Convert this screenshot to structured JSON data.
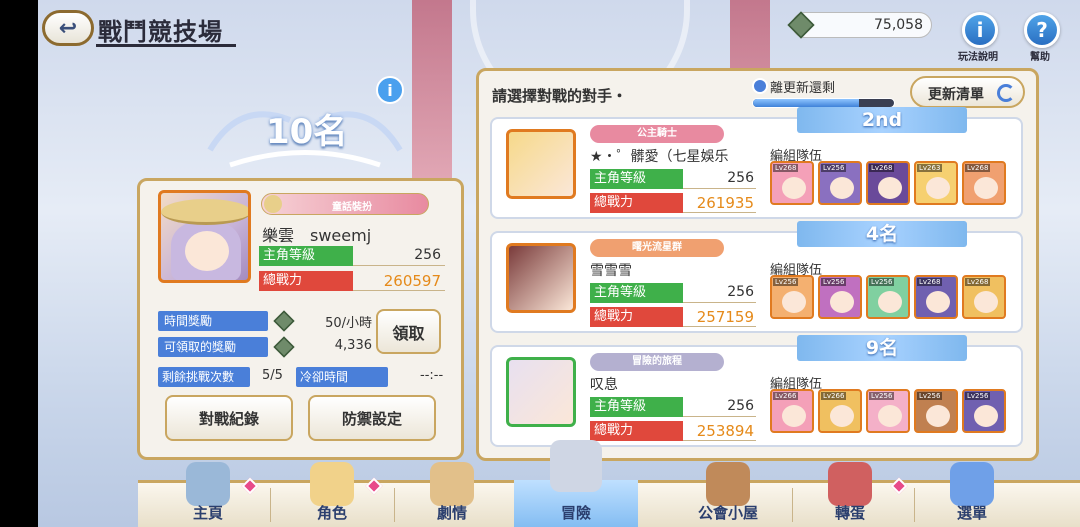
{
  "header": {
    "title": "戰鬥競技場",
    "currency_value": "75,058",
    "help_rules_label": "玩法說明",
    "help_label": "幫助"
  },
  "player": {
    "rank": "10名",
    "title_badge": "童話裝扮",
    "name": "樂雲　sweemj",
    "level_label": "主角等級",
    "level": "256",
    "power_label": "總戰力",
    "power": "260597",
    "hourly_reward_label": "時間獎勵",
    "hourly_reward_value": "50/小時",
    "claimable_label": "可領取的獎勵",
    "claimable_value": "4,336",
    "claim_button": "領取",
    "remaining_label": "剩餘挑戰次數",
    "remaining_value": "5/5",
    "cooldown_label": "冷卻時間",
    "cooldown_value": "--:--",
    "history_button": "對戰紀錄",
    "defense_button": "防禦設定"
  },
  "opponents_panel": {
    "prompt": "請選擇對戰的對手・",
    "timer_label": "離更新還剩",
    "timer_progress": 0.75,
    "refresh_button": "更新清單"
  },
  "opponents": [
    {
      "rank": "2nd",
      "title": "公主騎士",
      "title_color": "#e88aa0",
      "name": "★・゜髒愛（七星娛乐",
      "level_label": "主角等級",
      "level": "256",
      "power_label": "總戰力",
      "power": "261935",
      "team_label": "編組隊伍",
      "team": [
        "Lv268",
        "Lv256",
        "Lv268",
        "Lv263",
        "Lv268"
      ],
      "avatar_color": "#f6d98a"
    },
    {
      "rank": "4名",
      "title": "曙光流星群",
      "title_color": "#f0a070",
      "name": "雪雪雪",
      "level_label": "主角等級",
      "level": "256",
      "power_label": "總戰力",
      "power": "257159",
      "team_label": "編組隊伍",
      "team": [
        "Lv256",
        "Lv256",
        "Lv256",
        "Lv268",
        "Lv268"
      ],
      "avatar_color": "#7a3b3b"
    },
    {
      "rank": "9名",
      "title": "冒險的旅程",
      "title_color": "#b4b0d0",
      "name": "叹息",
      "level_label": "主角等級",
      "level": "256",
      "power_label": "總戰力",
      "power": "253894",
      "team_label": "編組隊伍",
      "team": [
        "Lv266",
        "Lv266",
        "Lv256",
        "Lv256",
        "Lv256"
      ],
      "avatar_color": "#e8e0f0"
    }
  ],
  "nav": [
    {
      "label": "主頁",
      "icon": "castle-icon"
    },
    {
      "label": "角色",
      "icon": "character-icon"
    },
    {
      "label": "劇情",
      "icon": "scroll-icon"
    },
    {
      "label": "冒險",
      "icon": "swords-icon"
    },
    {
      "label": "公會小屋",
      "icon": "house-icon"
    },
    {
      "label": "轉蛋",
      "icon": "gacha-icon"
    },
    {
      "label": "選單",
      "icon": "crystal-icon"
    }
  ]
}
